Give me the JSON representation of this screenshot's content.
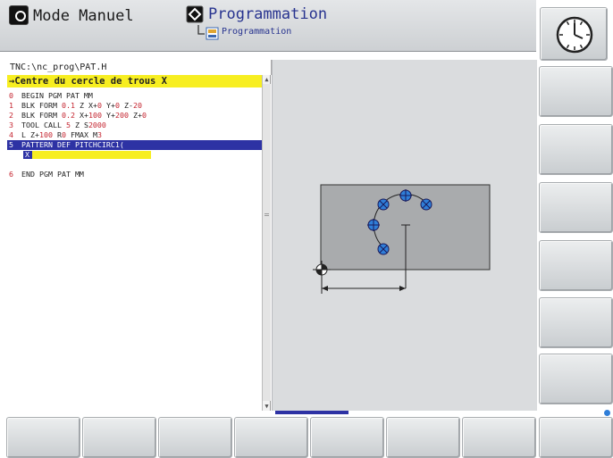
{
  "header": {
    "mode1": {
      "label": "Mode Manuel"
    },
    "mode2": {
      "label": "Programmation",
      "sublabel": "Programmation"
    }
  },
  "editor": {
    "path": "TNC:\\nc_prog\\PAT.H",
    "title": "→Centre du cercle de trous X",
    "lines": [
      {
        "num": "0",
        "text": "BEGIN PGM PAT MM"
      },
      {
        "num": "1",
        "text": "BLK FORM 0.1 Z X+0 Y+0 Z-20"
      },
      {
        "num": "2",
        "text": "BLK FORM 0.2  X+100  Y+200  Z+0"
      },
      {
        "num": "3",
        "text": "TOOL CALL 5 Z S2000"
      },
      {
        "num": "4",
        "text": "L  Z+100 R0 FMAX M3"
      },
      {
        "num": "5",
        "text": "PATTERN DEF PITCHCIRC1("
      },
      {
        "num": "",
        "text": "X"
      },
      {
        "num": "6",
        "text": "END PGM PAT MM"
      }
    ]
  },
  "colors": {
    "accent_blue": "#2d32a4",
    "title_yellow": "#f7ee21",
    "line_number_red": "#c4242f",
    "hole_blue": "#2f7ed8",
    "panel_gray": "#dadcde"
  },
  "icons": {
    "mode1": "manual-mode-icon",
    "mode2": "programming-mode-icon",
    "sub": "program-file-icon",
    "clock": "clock-icon"
  }
}
